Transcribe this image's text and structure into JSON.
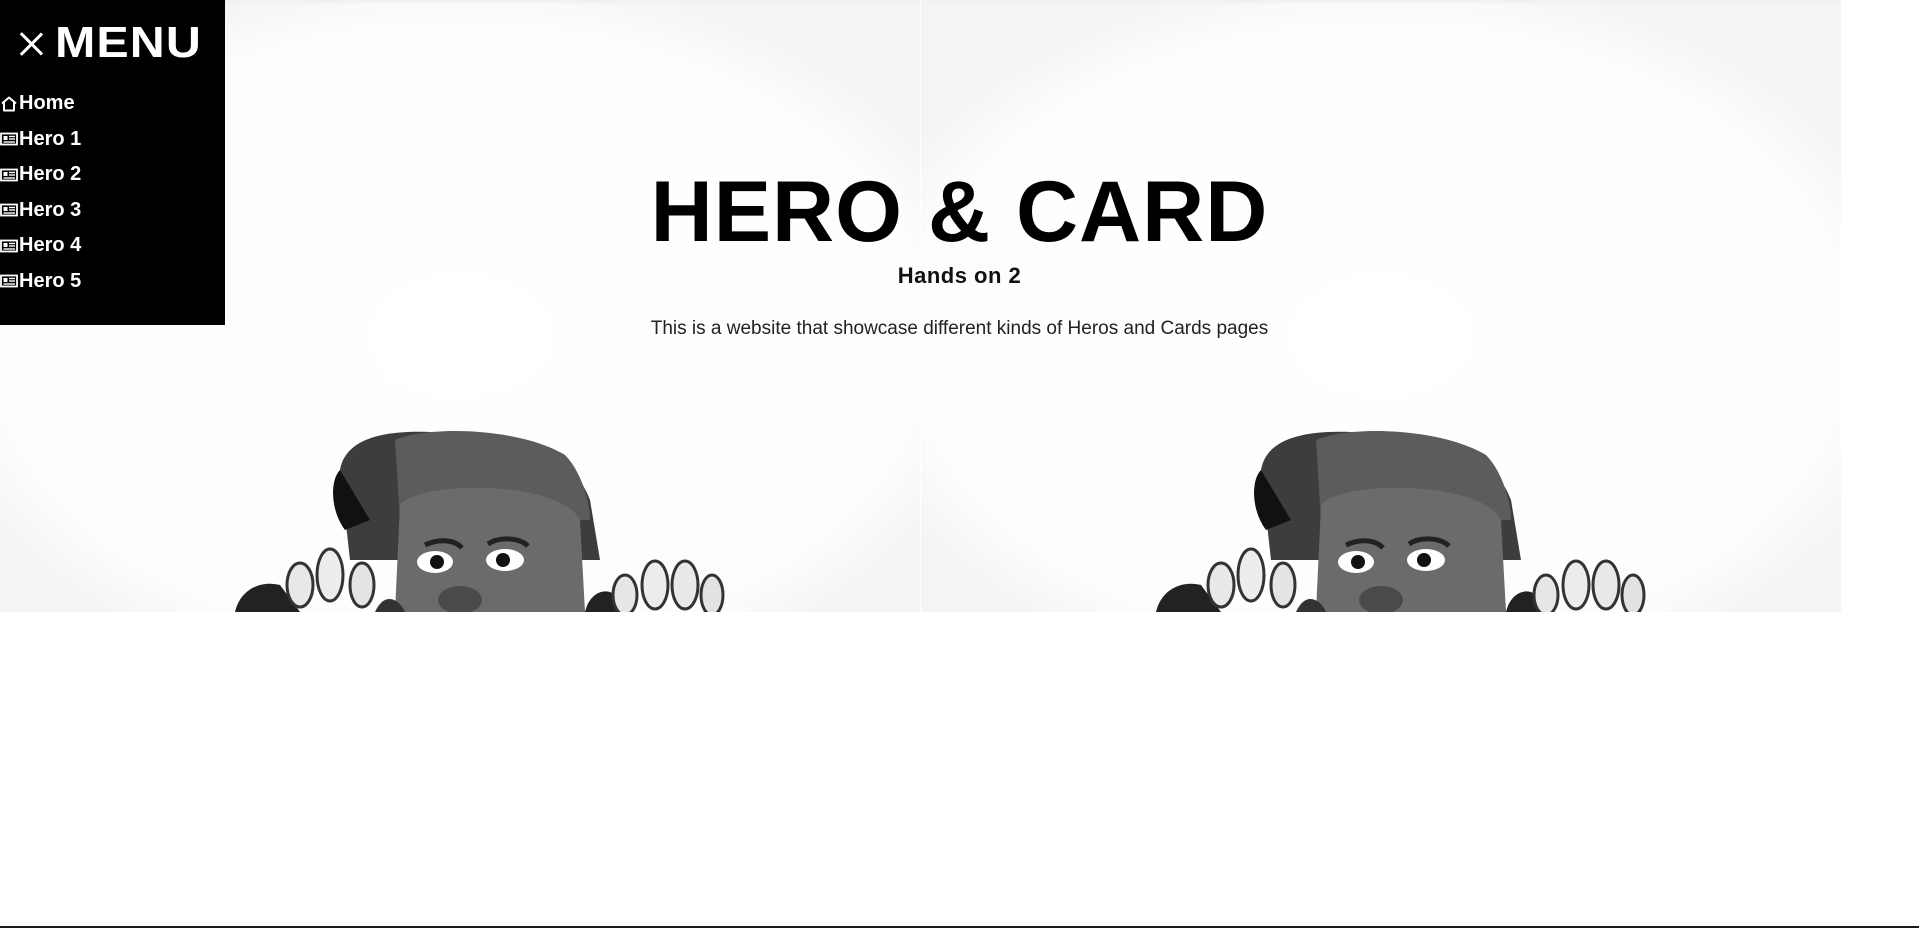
{
  "menu": {
    "title": "MENU",
    "close_icon": "close-icon",
    "items": [
      {
        "label": "Home",
        "icon": "home-icon"
      },
      {
        "label": "Hero 1",
        "icon": "id-card-icon"
      },
      {
        "label": "Hero 2",
        "icon": "id-card-icon"
      },
      {
        "label": "Hero 3",
        "icon": "id-card-icon"
      },
      {
        "label": "Hero 4",
        "icon": "id-card-icon"
      },
      {
        "label": "Hero 5",
        "icon": "id-card-icon"
      }
    ]
  },
  "hero": {
    "title": "HERO & CARD",
    "subtitle": "Hands on 2",
    "description": "This is a website that showcase different kinds of Heros and Cards pages"
  },
  "colors": {
    "menu_background": "#000000",
    "menu_text": "#ffffff",
    "page_background": "#ffffff",
    "title_text": "#000000"
  }
}
